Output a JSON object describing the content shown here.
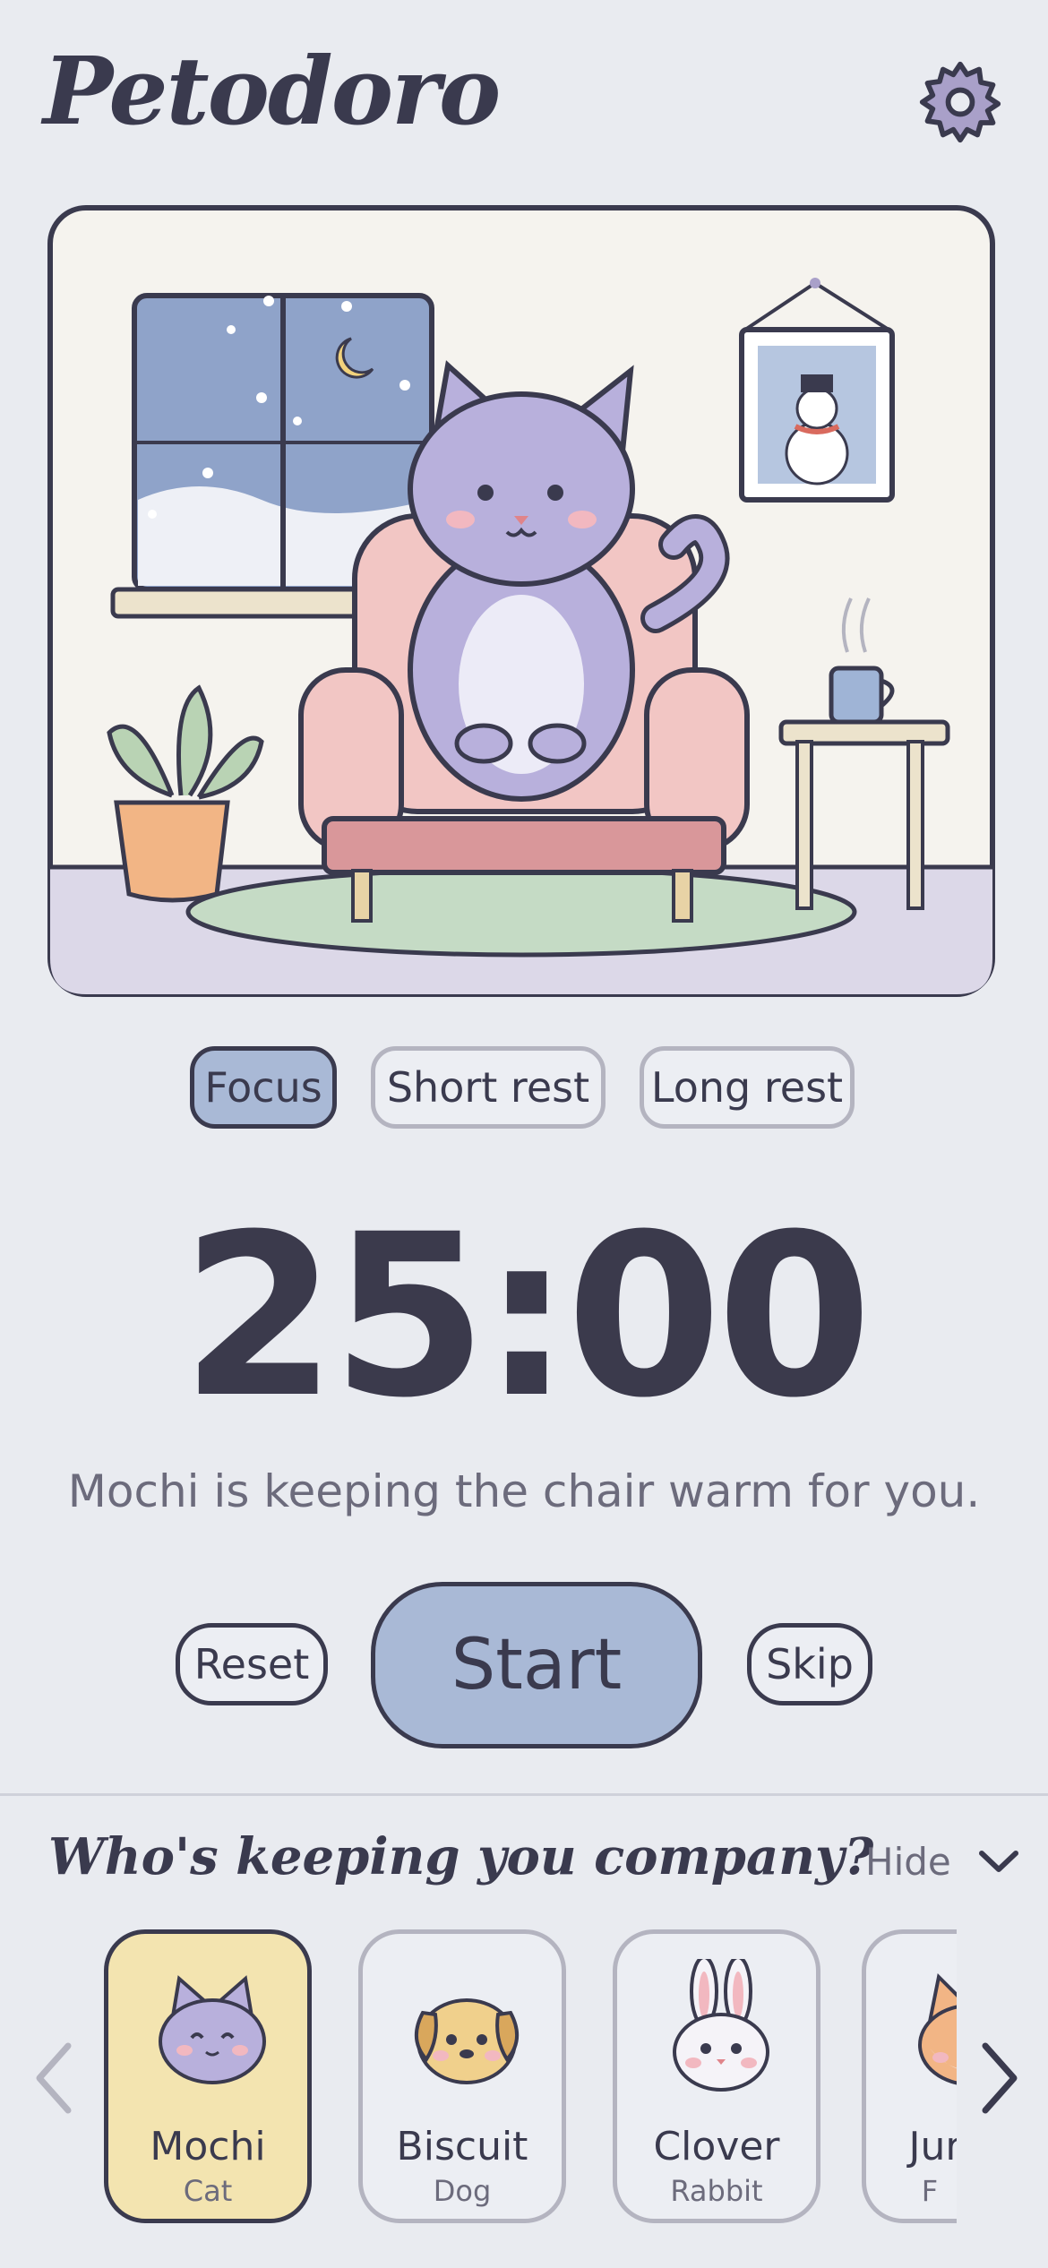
{
  "app": {
    "title": "Petodoro"
  },
  "modes": [
    {
      "label": "Focus",
      "active": true
    },
    {
      "label": "Short rest",
      "active": false
    },
    {
      "label": "Long rest",
      "active": false
    }
  ],
  "timer": {
    "display": "25:00"
  },
  "status": {
    "message": "Mochi is keeping the chair warm for you."
  },
  "controls": {
    "reset": "Reset",
    "start": "Start",
    "skip": "Skip"
  },
  "company": {
    "title": "Who's keeping you company?",
    "hide_label": "Hide",
    "pets": [
      {
        "name": "Mochi",
        "species": "Cat",
        "selected": true
      },
      {
        "name": "Biscuit",
        "species": "Dog",
        "selected": false
      },
      {
        "name": "Clover",
        "species": "Rabbit",
        "selected": false
      },
      {
        "name": "Jur",
        "species": "F",
        "selected": false
      }
    ]
  },
  "colors": {
    "background": "#e9ebf0",
    "accent_blue": "#a9b9d6",
    "selected_card": "#f3e4b0",
    "ink": "#3a3a4e",
    "muted": "#6c6b7c"
  },
  "icons": [
    "gear-icon",
    "chevron-down-icon",
    "chevron-left-icon",
    "chevron-right-icon"
  ]
}
